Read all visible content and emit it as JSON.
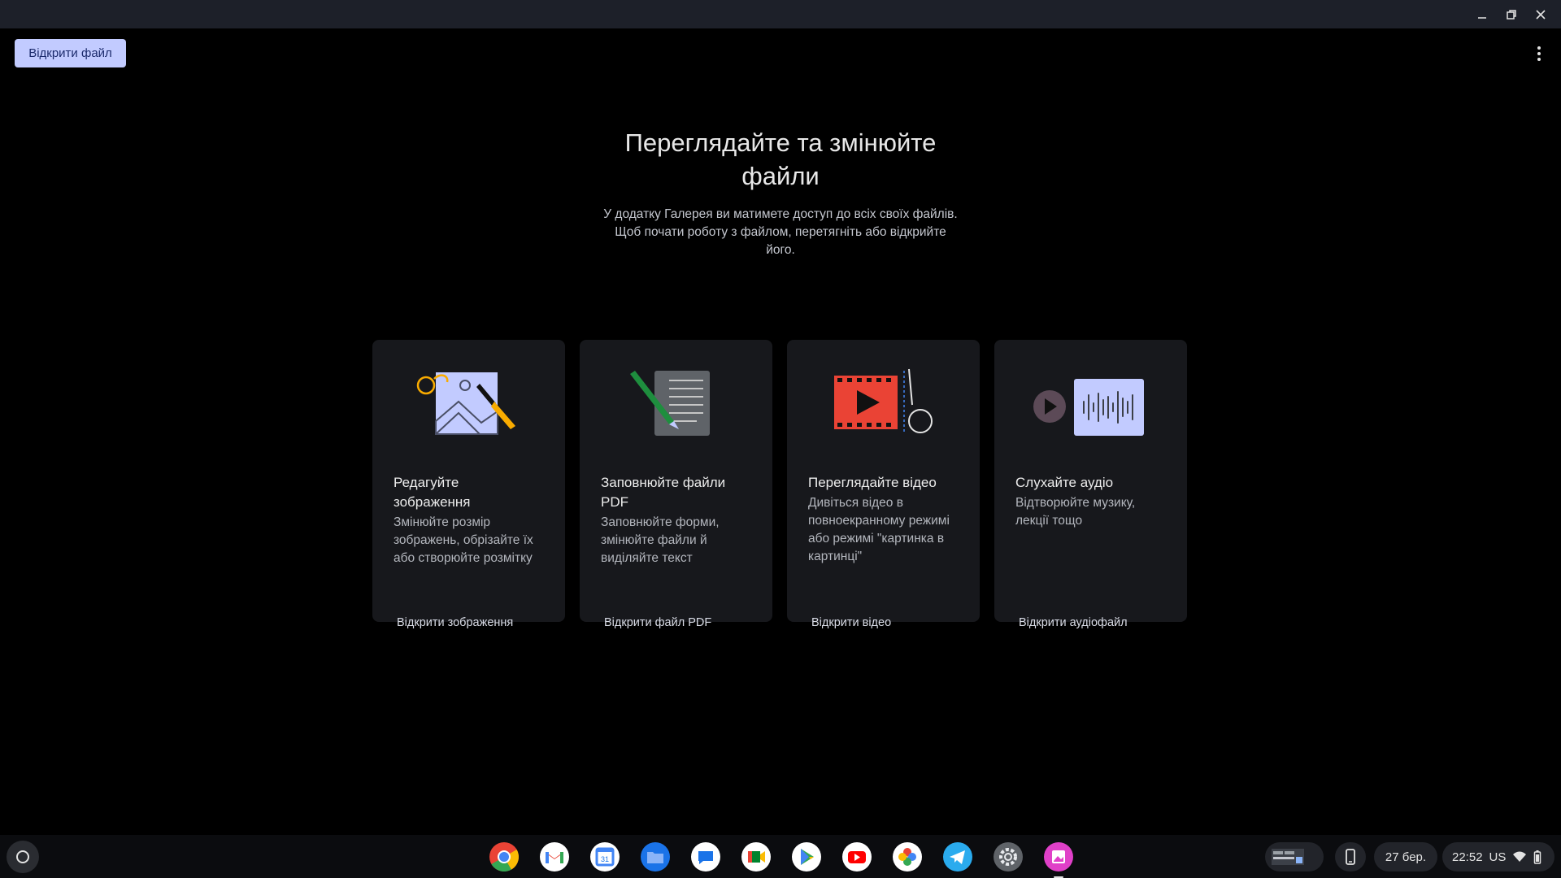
{
  "window": {
    "minimize_icon": "minimize-icon",
    "maximize_icon": "restore-icon",
    "close_icon": "close-icon"
  },
  "toolbar": {
    "open_file_label": "Відкрити файл",
    "menu_icon": "more-vert-icon"
  },
  "hero": {
    "title_line1": "Переглядайте та змінюйте",
    "title_line2": "файли",
    "desc_line1": "У додатку Галерея ви матимете доступ до всіх своїх файлів.",
    "desc_line2": "Щоб почати роботу з файлом, перетягніть або відкрийте",
    "desc_line3": "його."
  },
  "cards": [
    {
      "icon": "edit-image-illustration",
      "title_line1": "Редагуйте",
      "title_line2": "зображення",
      "desc_line1": "Змінюйте розмір",
      "desc_line2": "зображень, обрізайте їх",
      "desc_line3": "або створюйте розмітку",
      "desc_line4": "",
      "link": "Відкрити зображення"
    },
    {
      "icon": "pdf-document-illustration",
      "title_line1": "Заповнюйте файли",
      "title_line2": "PDF",
      "desc_line1": "Заповнюйте форми,",
      "desc_line2": "змінюйте файли й",
      "desc_line3": "виділяйте текст",
      "desc_line4": "",
      "link": "Відкрити файл PDF"
    },
    {
      "icon": "video-illustration",
      "title_line1": "Переглядайте відео",
      "title_line2": "",
      "desc_line1": "Дивіться відео в",
      "desc_line2": "повноекранному режимі",
      "desc_line3": "або режимі \"картинка в",
      "desc_line4": "картинці\"",
      "link": "Відкрити відео"
    },
    {
      "icon": "audio-illustration",
      "title_line1": "Слухайте аудіо",
      "title_line2": "",
      "desc_line1": "Відтворюйте музику,",
      "desc_line2": "лекції тощо",
      "desc_line3": "",
      "desc_line4": "",
      "link": "Відкрити аудіофайл"
    }
  ],
  "shelf": {
    "launcher_icon": "launcher-icon",
    "apps": [
      "chrome-icon",
      "gmail-icon",
      "calendar-icon",
      "files-icon",
      "messages-icon",
      "meet-icon",
      "play-store-icon",
      "youtube-icon",
      "photos-icon",
      "telegram-icon",
      "settings-icon",
      "gallery-icon"
    ],
    "calendar_day": "31",
    "date": "27 бер.",
    "time": "22:52",
    "keyboard_layout": "US",
    "colors": {
      "chrome_red": "#ea4335",
      "chrome_yellow": "#fbbc04",
      "chrome_green": "#34a853",
      "google_blue": "#4285f4",
      "gallery_pink": "#e040c8"
    }
  }
}
